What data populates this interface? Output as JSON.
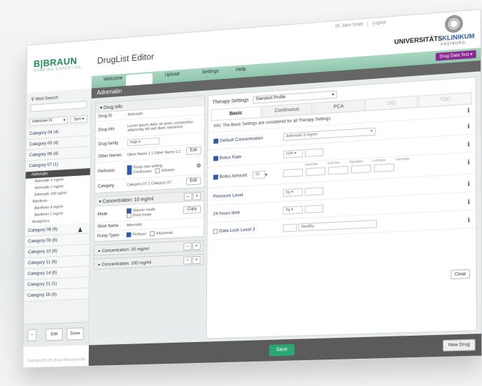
{
  "header": {
    "logo": "B|BRAUN",
    "logo_sub": "SHARING EXPERTISE",
    "app_title": "DrugList Editor",
    "user_name": "Dr. John Smith",
    "logout": "Logout",
    "uni_name_a": "UNIVERSITÄTS",
    "uni_name_b": "KLINIKUM",
    "uni_sub": "FREIBURG"
  },
  "nav": {
    "tabs": [
      "Welcome",
      "Upload",
      "Settings",
      "Help"
    ],
    "dropdown": "Drug Data Test"
  },
  "sidebar": {
    "search_label": "Med Search",
    "list_select": "Intensive IV",
    "sort_btn": "Sort",
    "categories": [
      "Category 04 (4)",
      "Category 05 (4)",
      "Category 06 (4)",
      "Category 07 (1)"
    ],
    "selected_group": "Adrenalin",
    "group_items": [
      "Adrenalin 5 mg/ml",
      "Adrenalin 1 mg/ml",
      "Adrenalin 100 ug/ml"
    ],
    "group2": "Alprifenin",
    "group2_items": [
      "Alprifenin 4 mg/ml",
      "Alprifenin 1 mg/ml"
    ],
    "group3": "Analgesics",
    "categories_after": [
      "Category 08 (9)",
      "Category 09 (6)",
      "Category 10 (6)",
      "Category 11 (6)",
      "Category 14 (6)",
      "Category 21 (1)",
      "Category 28 (6)"
    ],
    "footer": {
      "minus": "–",
      "edit": "Edit",
      "done": "Done"
    }
  },
  "main": {
    "drug_name": "Adrenalin",
    "drug_info": {
      "title": "Drug info",
      "rows": [
        {
          "k": "Drug ID",
          "v": "Adrenalin"
        },
        {
          "k": "Drug info",
          "v": "Lorem ipsum dolor sit amet, consectetur adipiscing elit sed diam nonummy"
        },
        {
          "k": "Drug family",
          "v": "High"
        },
        {
          "k": "Other Names",
          "v": "Other Name 1.1 Other Name 2.1"
        },
        {
          "k": "Perfusion",
          "v": "Pump own setting"
        },
        {
          "k": "Category",
          "v": "Category 07.1 Category 07"
        }
      ],
      "perfusion_opts": [
        "Continuous",
        "Infusion"
      ],
      "edit": "Edit"
    },
    "conc1": {
      "title": "Concentration: 10 mg/ml",
      "mode_label": "Mode",
      "mode_opts": [
        "Volume mode",
        "Dose mode"
      ],
      "copy": "Copy",
      "short_label": "Short Name",
      "short_value": "Adrenalin",
      "pump_label": "Pump Types",
      "pump_opts": [
        "Perfusor",
        "Infusomat"
      ]
    },
    "conc2": "Concentration: 20 mg/ml",
    "conc3": "Concentration: 100 mg/ml",
    "therapy": {
      "label": "Therapy Settings",
      "profile": "Standard Profile",
      "tabs": [
        "Basic",
        "Continuous",
        "PCA",
        "SID",
        "TDC"
      ],
      "info": "Info: The Basic Settings are considered for all Therapy Settings.",
      "rows": [
        {
          "label": "Default Concentration",
          "value": "Adrenalin 5 mg/ml"
        },
        {
          "label": "Bolus Rate",
          "value": "ml/h"
        },
        {
          "label": "Bolus Amount",
          "value": "10"
        },
        {
          "label": "Pressure Level",
          "value": "5g"
        },
        {
          "label": "24 hours limit",
          "value": "5g"
        },
        {
          "label": "Data Lock Level 3",
          "value": "Healthy"
        }
      ],
      "col_headers": [
        "Hard Min",
        "Soft Min",
        "Standard",
        "Soft Max",
        "Hard Max"
      ],
      "clear": "Clear"
    }
  },
  "footer": {
    "save": "Save",
    "new_drug": "New Drug",
    "copyright": "Copyright 2013 B. Braun Melsungen AG"
  }
}
